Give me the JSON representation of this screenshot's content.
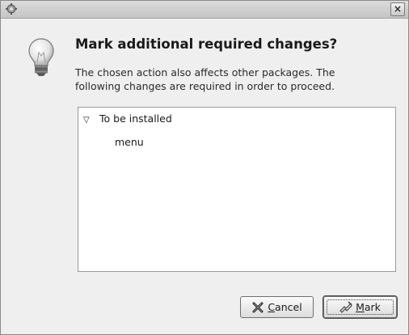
{
  "dialog": {
    "title_icon": "package-manager-icon",
    "close_glyph": "×",
    "heading": "Mark additional required changes?",
    "description": "The chosen action also affects other packages. The following changes are required in order to proceed.",
    "icon": "lightbulb-icon"
  },
  "changes": {
    "group_label": "To be installed",
    "expander_glyph": "▽",
    "items": [
      {
        "label": "menu"
      }
    ]
  },
  "buttons": {
    "cancel": {
      "accel": "C",
      "rest": "ancel",
      "icon": "cancel-x-icon"
    },
    "mark": {
      "accel": "M",
      "rest": "ark",
      "icon": "mark-wrench-icon"
    }
  }
}
